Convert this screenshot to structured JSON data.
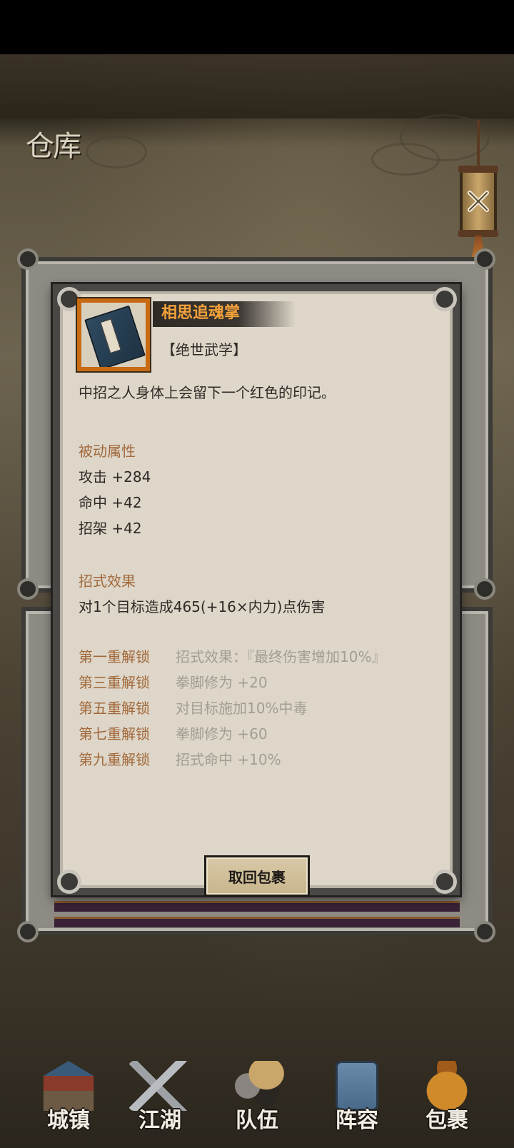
{
  "page": {
    "title": "仓库"
  },
  "item": {
    "name": "相思追魂掌",
    "type": "【绝世武学】",
    "description": "中招之人身体上会留下一个红色的印记。",
    "passive_title": "被动属性",
    "passive_stats": [
      "攻击 +284",
      "命中 +42",
      "招架 +42"
    ],
    "effect_title": "招式效果",
    "effect_text": "对1个目标造成465(+16×内力)点伤害",
    "unlocks": [
      {
        "label": "第一重解锁",
        "value": "招式效果：『最终伤害增加10%』"
      },
      {
        "label": "第三重解锁",
        "value": "拳脚修为 +20"
      },
      {
        "label": "第五重解锁",
        "value": "对目标施加10%中毒"
      },
      {
        "label": "第七重解锁",
        "value": "拳脚修为 +60"
      },
      {
        "label": "第九重解锁",
        "value": "招式命中 +10%"
      }
    ],
    "return_button": "取回包裹",
    "icon": "book-icon"
  },
  "nav": [
    {
      "label": "城镇",
      "icon": "town-icon"
    },
    {
      "label": "江湖",
      "icon": "swords-icon"
    },
    {
      "label": "队伍",
      "icon": "team-icon"
    },
    {
      "label": "阵容",
      "icon": "formation-icon"
    },
    {
      "label": "包裹",
      "icon": "bag-icon"
    }
  ],
  "colors": {
    "accent_orange": "#f4a23a",
    "section_brown": "#a2683a",
    "muted_text": "#a29d94",
    "panel_bg": "#ddd6c9"
  }
}
